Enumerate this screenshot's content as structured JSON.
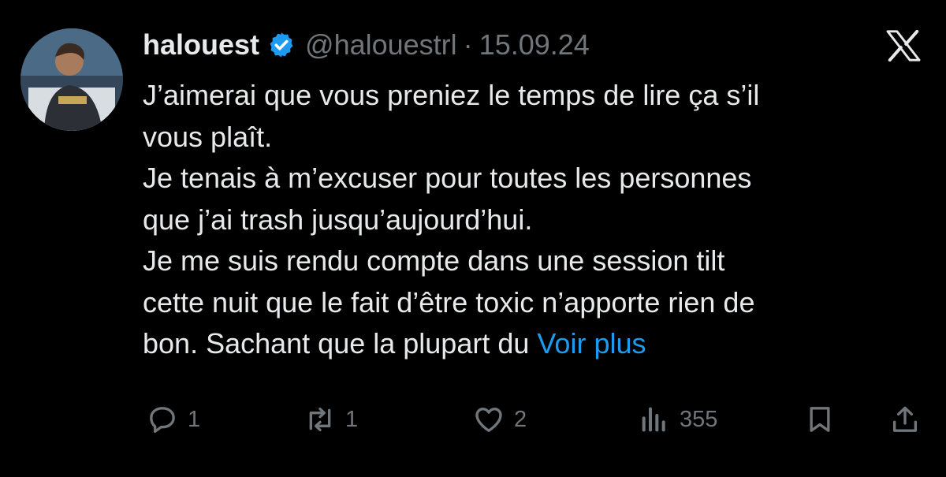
{
  "tweet": {
    "display_name": "halouest",
    "handle": "@halouestrl",
    "separator": "·",
    "date": "15.09.24",
    "lines": [
      "J’aimerai que vous preniez le temps de lire ça s’il",
      "vous plaît.",
      "Je tenais à m’excuser pour toutes les personnes",
      "que j’ai trash jusqu’aujourd’hui.",
      "Je me suis rendu compte dans une session tilt",
      "cette nuit que le fait d’être toxic n’apporte rien de",
      "bon. Sachant que la plupart du"
    ],
    "more_link": "Voir plus"
  },
  "actions": {
    "replies": "1",
    "retweets": "1",
    "likes": "2",
    "views": "355"
  },
  "icons": {
    "verified": "verified-badge-icon",
    "brand": "x-logo-icon",
    "reply": "reply-icon",
    "retweet": "retweet-icon",
    "like": "heart-icon",
    "views": "views-icon",
    "bookmark": "bookmark-icon",
    "share": "share-icon"
  },
  "colors": {
    "background": "#000000",
    "text": "#e7e9ea",
    "secondary": "#71767b",
    "accent": "#1d9bf0"
  }
}
